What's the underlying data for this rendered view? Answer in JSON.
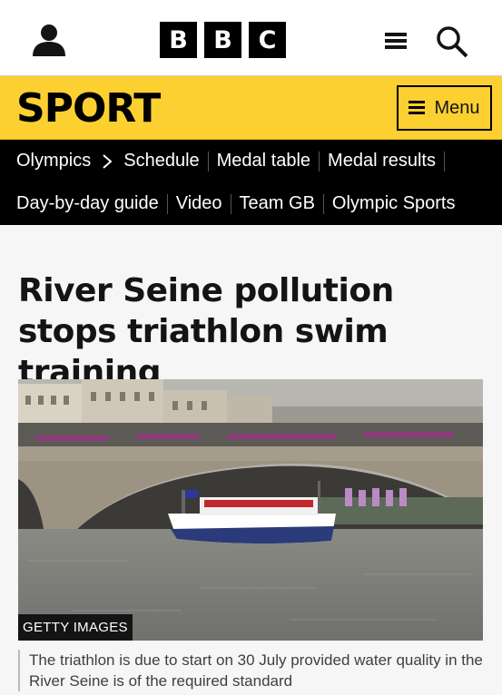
{
  "header": {
    "logo_letters": [
      "B",
      "B",
      "C"
    ],
    "icons": {
      "account": "person-icon",
      "menu": "hamburger-icon",
      "search": "search-icon"
    }
  },
  "section": {
    "title": "SPORT",
    "menu_label": "Menu",
    "accent_color": "#fdd032"
  },
  "nav": {
    "row1": [
      "Olympics",
      "Schedule",
      "Medal table",
      "Medal results"
    ],
    "row2": [
      "Day-by-day guide",
      "Video",
      "Team GB",
      "Olympic Sports"
    ]
  },
  "article": {
    "headline": "River Seine pollution stops triathlon swim training",
    "image_credit": "GETTY IMAGES",
    "caption": "The triathlon is due to start on 30 July provided water quality in the River Seine is of the required standard"
  }
}
